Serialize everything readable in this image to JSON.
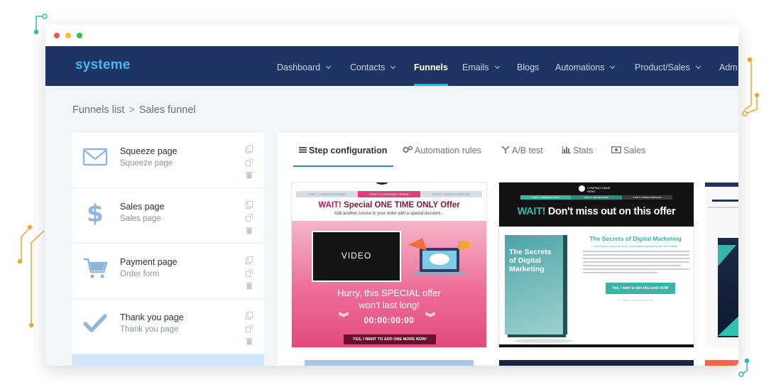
{
  "app": {
    "logo": "systeme",
    "nav": [
      {
        "label": "Dashboard",
        "dropdown": true,
        "active": false
      },
      {
        "label": "Contacts",
        "dropdown": true,
        "active": false
      },
      {
        "label": "Funnels",
        "dropdown": false,
        "active": true
      },
      {
        "label": "Emails",
        "dropdown": true,
        "active": false
      },
      {
        "label": "Blogs",
        "dropdown": false,
        "active": false
      },
      {
        "label": "Automations",
        "dropdown": true,
        "active": false
      },
      {
        "label": "Product/Sales",
        "dropdown": true,
        "active": false
      },
      {
        "label": "Adm",
        "dropdown": false,
        "active": false
      }
    ]
  },
  "breadcrumb": {
    "root": "Funnels list",
    "separator": ">",
    "current": "Sales funnel"
  },
  "steps": [
    {
      "title": "Squeeze page",
      "subtitle": "Squeeze page",
      "icon": "envelope-icon"
    },
    {
      "title": "Sales page",
      "subtitle": "Sales page",
      "icon": "dollar-icon"
    },
    {
      "title": "Payment page",
      "subtitle": "Order form",
      "icon": "cart-icon"
    },
    {
      "title": "Thank you page",
      "subtitle": "Thank you page",
      "icon": "checkmark-icon"
    }
  ],
  "tabs": [
    {
      "label": "Step configuration",
      "icon": "list-icon",
      "active": true
    },
    {
      "label": "Automation rules",
      "icon": "gears-icon",
      "active": false
    },
    {
      "label": "A/B test",
      "icon": "split-icon",
      "active": false
    },
    {
      "label": "Stats",
      "icon": "bar-chart-icon",
      "active": false
    },
    {
      "label": "Sales",
      "icon": "money-icon",
      "active": false
    }
  ],
  "template1": {
    "progress": [
      "STEP 1: CREATE ACCOUNT",
      "STEP 2: CUSTOMIZE ORDER",
      "STEP 3: ORDER COMPLETE"
    ],
    "headline_wait": "WAIT!",
    "headline_rest": " Special ONE TIME ONLY Offer",
    "subline": "Add another course to your order with a special discount...",
    "video_label": "VIDEO",
    "hurry_line1": "Hurry, this SPECIAL offer",
    "hurry_line2": "won't last long!",
    "countdown": "00:00:00:00",
    "cta": "YES, I WANT TO ADD ONE MORE NOW!",
    "accent": "#e43d7c"
  },
  "template2": {
    "logo": "COMPANY NAME HERE",
    "progress": [
      "STEP 1: ORDER ACCOUNT",
      "STEP 2: DELIVER MADE",
      "STEP 3: ORDER COMPLETE"
    ],
    "headline_wait": "WAIT!",
    "headline_rest": " Don't miss out on this offer",
    "book_title": "The Secrets of Digital Marketing",
    "title": "The Secrets of Digital Marketing",
    "tagline": "\"Lorem ipsum dolor sit amet, consectetur adipiscing elit. Sed blandit\"",
    "cta": "Yes, I want to add this book NOW",
    "decline": "No Thanks, I don't need this offer",
    "accent": "#36b6a4"
  }
}
